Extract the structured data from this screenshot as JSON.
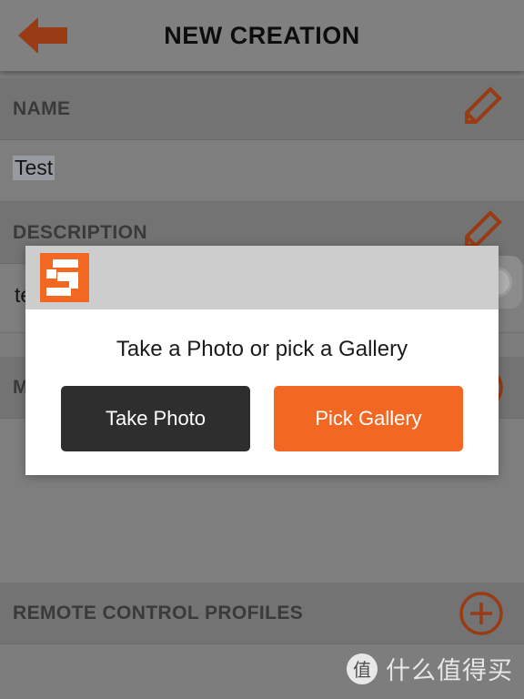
{
  "appbar": {
    "title": "NEW CREATION",
    "back_icon": "back-arrow-icon"
  },
  "form": {
    "name_section": {
      "label": "NAME",
      "edit_icon": "pencil-icon",
      "value": "Test"
    },
    "description_section": {
      "label": "DESCRIPTION",
      "edit_icon": "pencil-icon",
      "value": "te"
    },
    "media_section": {
      "label": "M",
      "add_icon": "plus-circle-icon"
    },
    "remote_section": {
      "label": "REMOTE CONTROL PROFILES",
      "add_icon": "plus-circle-icon"
    }
  },
  "camera_button": {
    "icon": "camera-shutter-icon"
  },
  "dialog": {
    "app_logo_icon": "app-logo-icon",
    "message": "Take a Photo or pick a Gallery",
    "buttons": [
      {
        "label": "Take Photo",
        "style": "dark",
        "name": "take-photo-button"
      },
      {
        "label": "Pick Gallery",
        "style": "orange",
        "name": "pick-gallery-button"
      }
    ]
  },
  "watermark": {
    "badge": "值",
    "text": "什么值得买"
  },
  "colors": {
    "accent_orange": "#f26722",
    "dim_orange": "#993b14",
    "dark_button": "#2e2e2e",
    "page_gray": "#7d7d7d",
    "section_gray": "#737373",
    "dialog_titlebar": "#cdcdcd"
  }
}
